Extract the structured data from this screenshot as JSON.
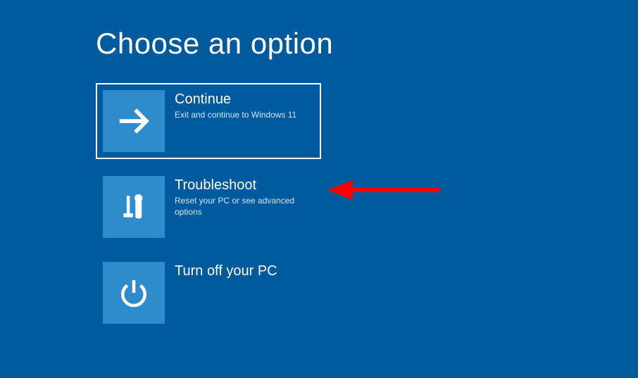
{
  "title": "Choose an option",
  "options": [
    {
      "title": "Continue",
      "desc": "Exit and continue to Windows 11"
    },
    {
      "title": "Troubleshoot",
      "desc": "Reset your PC or see advanced options"
    },
    {
      "title": "Turn off your PC",
      "desc": ""
    }
  ]
}
